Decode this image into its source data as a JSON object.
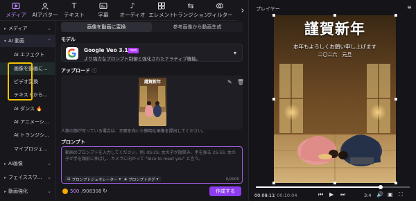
{
  "toolbar": {
    "tabs": [
      {
        "label": "メディア",
        "icon": "media-icon"
      },
      {
        "label": "AIアバター",
        "icon": "ai-avatar-icon"
      },
      {
        "label": "テキスト",
        "icon": "text-icon"
      },
      {
        "label": "字幕",
        "icon": "caption-icon"
      },
      {
        "label": "オーディオ",
        "icon": "audio-icon"
      },
      {
        "label": "エレメント",
        "icon": "element-icon"
      },
      {
        "label": "トランジション",
        "icon": "transition-icon"
      },
      {
        "label": "フィルター",
        "icon": "filter-icon"
      }
    ],
    "active_tab": "メディア",
    "accent": "#c08cff"
  },
  "sidebar": {
    "items": [
      {
        "label": "メディア",
        "expandable": true
      },
      {
        "label": "AI 動画",
        "expandable": true,
        "open": true
      },
      {
        "label": "AI エフェクト",
        "sub": true
      },
      {
        "label": "画像を動画に...",
        "sub": true,
        "selected": true
      },
      {
        "label": "ビデオ変換",
        "sub": true
      },
      {
        "label": "テキストから...",
        "sub": true
      },
      {
        "label": "AI ダンス",
        "sub": true,
        "emoji": "🔥"
      },
      {
        "label": "AI アニメーシ...",
        "sub": true
      },
      {
        "label": "AI トランジシ...",
        "sub": true
      },
      {
        "label": "マイプロジェ...",
        "sub": true
      },
      {
        "label": "AI画像",
        "expandable": true
      },
      {
        "label": "フェイススワ...",
        "expandable": true
      },
      {
        "label": "動画強化",
        "expandable": true
      }
    ],
    "highlight_color": "#f5c400"
  },
  "main": {
    "mode_tabs": [
      "画像を動画に変換",
      "参考画像から動画生成"
    ],
    "active_mode": "画像を動画に変換",
    "model_section": "モデル",
    "model": {
      "name": "Google Veo 3.1",
      "badge": "new",
      "description": "より強力なプロンプト制御と強化されたナラティブ機能。"
    },
    "upload_section": "アップロード",
    "upload_note": "人物の顔が写っている場合は、正面を向いた鮮明な画像を提出してください。",
    "prompt_section": "プロンプト",
    "prompt_placeholder": "動画のプロンプトを入力してください。例: 0S-2S: 女の子が微笑み、手を振る 2S-5S: 女の子が手を顔前に伸ばし、カメラに向かって \"Nice to meet you\" と言う。",
    "prompt_generator_label": "プロンプトジェネレーター",
    "prompt_tag_label": "プロンプトタグ",
    "char_count": "0/2000",
    "credits_used": "500",
    "credits_total": "/908308",
    "create_label": "作成する",
    "create_color": "#8c3df0"
  },
  "player": {
    "title": "プレイヤー",
    "preview_title": "謹賀新年",
    "preview_line1": "本年もよろしくお願い申し上げます",
    "preview_line2": "二〇二六　元旦",
    "time_current": "00:08:11",
    "time_total": "/ 00:10:04",
    "progress": 0.81,
    "aspect": "3:4"
  }
}
